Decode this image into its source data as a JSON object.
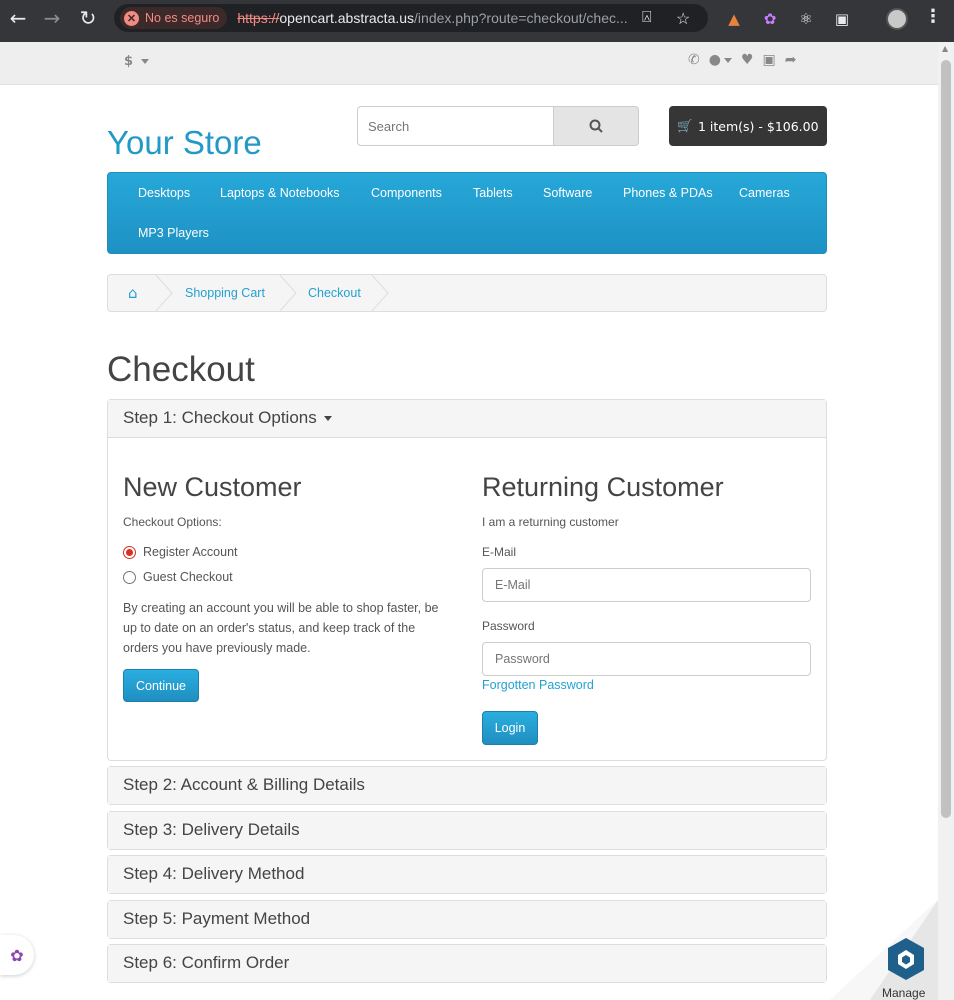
{
  "browser": {
    "security_label": "No es seguro",
    "url_scheme": "https://",
    "url_host": "opencart.abstracta.us",
    "url_path": "/index.php?route=checkout/chec..."
  },
  "topbar": {
    "currency": "$"
  },
  "header": {
    "logo": "Your Store",
    "search_placeholder": "Search",
    "cart_label": "1 item(s) - $106.00"
  },
  "menu": {
    "items": [
      "Desktops",
      "Laptops & Notebooks",
      "Components",
      "Tablets",
      "Software",
      "Phones & PDAs",
      "Cameras",
      "MP3 Players"
    ]
  },
  "breadcrumb": {
    "items": [
      "Shopping Cart",
      "Checkout"
    ]
  },
  "page": {
    "title": "Checkout"
  },
  "step1": {
    "heading": "Step 1: Checkout Options",
    "new_customer": {
      "title": "New Customer",
      "options_label": "Checkout Options:",
      "option_register": "Register Account",
      "option_guest": "Guest Checkout",
      "selected": "Register Account",
      "description": "By creating an account you will be able to shop faster, be up to date on an order's status, and keep track of the orders you have previously made.",
      "continue_label": "Continue"
    },
    "returning_customer": {
      "title": "Returning Customer",
      "subtitle": "I am a returning customer",
      "email_label": "E-Mail",
      "email_placeholder": "E-Mail",
      "password_label": "Password",
      "password_placeholder": "Password",
      "forgotten_link": "Forgotten Password",
      "login_label": "Login"
    }
  },
  "steps": [
    "Step 2: Account & Billing Details",
    "Step 3: Delivery Details",
    "Step 4: Delivery Method",
    "Step 5: Payment Method",
    "Step 6: Confirm Order"
  ],
  "widgets": {
    "manage_label": "Manage"
  },
  "colors": {
    "brand_blue": "#229ac8",
    "menu_blue": "#229ac8",
    "button_blue": "#229ac8",
    "cart_dark": "#363636"
  }
}
